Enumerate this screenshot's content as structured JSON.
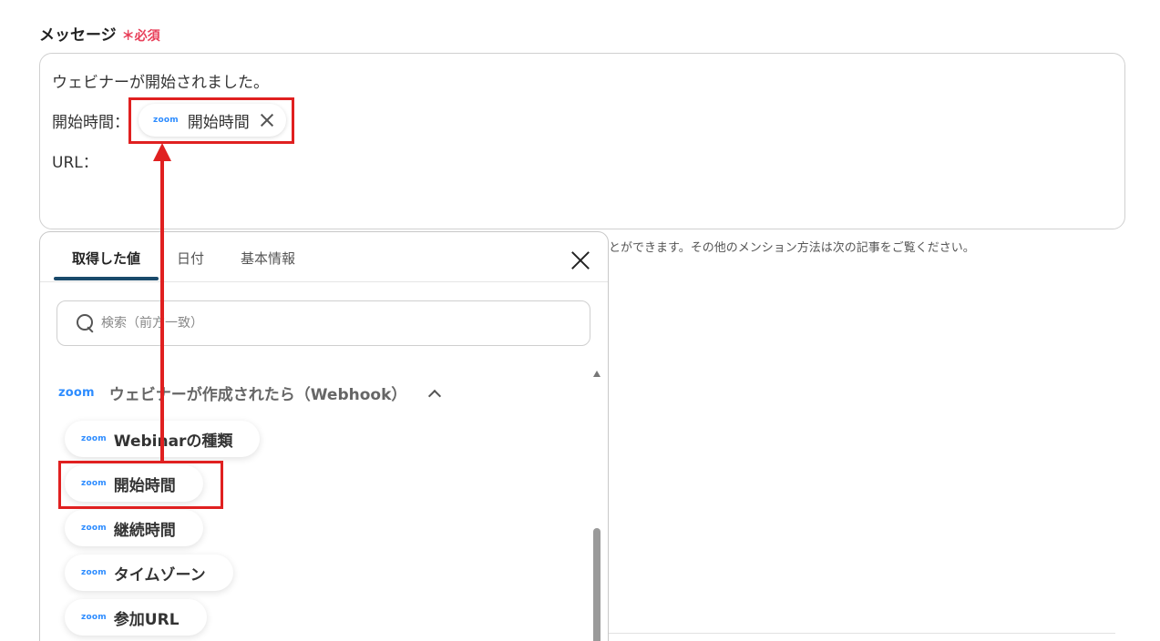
{
  "field": {
    "label": "メッセージ",
    "required_mark": "＊",
    "required_text": "必須"
  },
  "editor": {
    "line1": "ウェビナーが開始されました。",
    "line2_prefix": "開始時間：",
    "line3": "URL：",
    "chip": {
      "logo": "zoom",
      "label": "開始時間"
    }
  },
  "help_text": "とができます。その他のメンション方法は次の記事をご覧ください。",
  "panel": {
    "tabs": [
      {
        "label": "取得した値",
        "active": true
      },
      {
        "label": "日付",
        "active": false
      },
      {
        "label": "基本情報",
        "active": false
      }
    ],
    "search": {
      "placeholder": "検索（前方一致）",
      "value": ""
    },
    "group": {
      "logo": "zoom",
      "title": "ウェビナーが作成されたら（Webhook）"
    },
    "items": [
      {
        "logo": "zoom",
        "label": "Webinarの種類"
      },
      {
        "logo": "zoom",
        "label": "開始時間"
      },
      {
        "logo": "zoom",
        "label": "継続時間"
      },
      {
        "logo": "zoom",
        "label": "タイムゾーン"
      },
      {
        "logo": "zoom",
        "label": "参加URL"
      }
    ]
  },
  "colors": {
    "accent_tab": "#1a4a6b",
    "required": "#e8405a",
    "zoom_blue": "#2d8cff",
    "annotation_red": "#e02020"
  }
}
